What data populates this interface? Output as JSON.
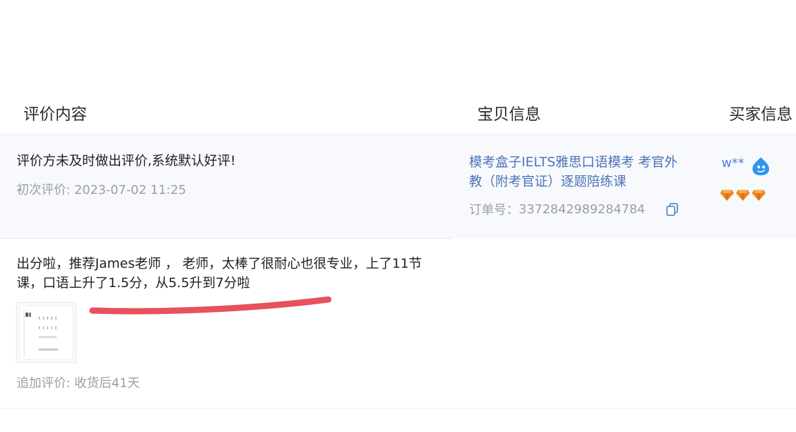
{
  "table_header": {
    "review_content": "评价内容",
    "item_info": "宝贝信息",
    "buyer_info": "买家信息"
  },
  "reviews": [
    {
      "text": "评价方未及时做出评价,系统默认好评!",
      "meta": "初次评价: 2023-07-02 11:25"
    },
    {
      "text": "出分啦，推荐James老师 ， 老师，太棒了很耐心也很专业，上了11节课，口语上升了1.5分，从5.5升到7分啦",
      "meta": "追加评价: 收货后41天"
    }
  ],
  "item": {
    "title": "模考盒子IELTS雅思口语模考 考官外教（附考官证）逐题陪练课",
    "order_label": "订单号：",
    "order_number": "3372842989284784"
  },
  "buyer": {
    "name": "w**",
    "level_icon": "diamond-icon",
    "level_count": 3
  },
  "colors": {
    "link_blue": "#4d73b8",
    "buyer_blue": "#4b7fe0",
    "underline_red": "#e8525a",
    "gem_orange": "#f08a2a"
  }
}
